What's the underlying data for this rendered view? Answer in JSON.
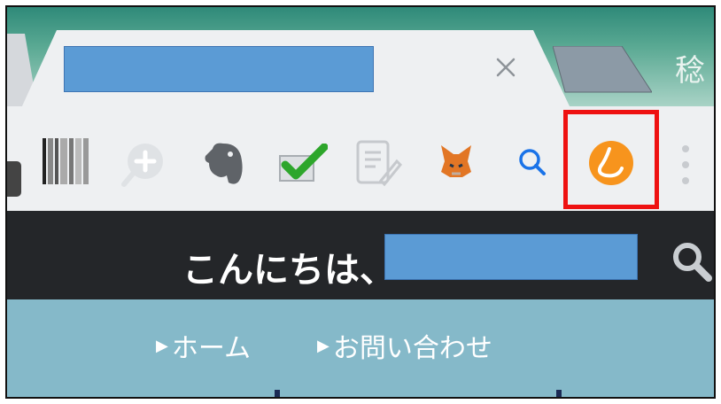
{
  "browser": {
    "title_glyph": "稔",
    "active_tab": {
      "close_label": "×"
    },
    "toolbar": {
      "extensions": [
        {
          "icon": "barcode-icon"
        },
        {
          "icon": "zoom-in-icon"
        },
        {
          "icon": "evernote-elephant-icon"
        },
        {
          "icon": "checkmark-icon"
        },
        {
          "icon": "note-edit-icon"
        },
        {
          "icon": "metamask-fox-icon"
        },
        {
          "icon": "search-icon"
        },
        {
          "icon": "orange-extension-icon"
        },
        {
          "icon": "more-menu-icon"
        }
      ],
      "highlight_color": "#ee1111"
    }
  },
  "site": {
    "header": {
      "greeting": "こんにちは、"
    },
    "nav": [
      {
        "label": "ホーム"
      },
      {
        "label": "お問い合わせ"
      }
    ]
  }
}
